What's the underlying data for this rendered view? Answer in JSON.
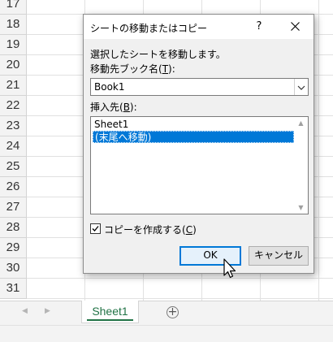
{
  "sheet": {
    "row_numbers": [
      "17",
      "18",
      "19",
      "20",
      "21",
      "22",
      "23",
      "24",
      "25",
      "26",
      "27",
      "28",
      "29",
      "30",
      "31"
    ],
    "tab_name": "Sheet1",
    "add_sheet_symbol": "+",
    "nav_prev_icon": "triangle-left",
    "nav_next_icon": "triangle-right"
  },
  "dialog": {
    "title": "シートの移動またはコピー",
    "help_label": "?",
    "close_label": "×",
    "instruction": "選択したシートを移動します。",
    "book_label_prefix": "移動先ブック名(",
    "book_label_accel": "T",
    "book_label_suffix": "):",
    "book_value": "Book1",
    "insert_label_prefix": "挿入先(",
    "insert_label_accel": "B",
    "insert_label_suffix": "):",
    "insert_items": [
      "Sheet1",
      "(末尾へ移動)"
    ],
    "selected_item_index": 1,
    "copy_label_prefix": "コピーを作成する(",
    "copy_label_accel": "C",
    "copy_label_suffix": ")",
    "copy_checked": true,
    "ok_label": "OK",
    "cancel_label": "キャンセル"
  },
  "colors": {
    "accent": "#0078d7",
    "sheet_tab": "#217346",
    "selection": "#0078d7"
  }
}
